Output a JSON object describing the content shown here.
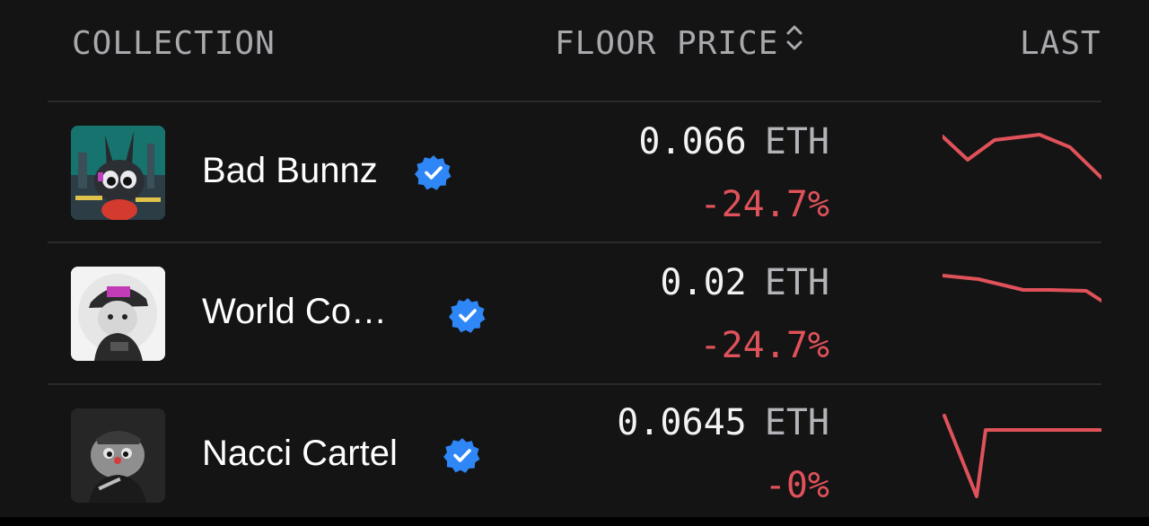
{
  "header": {
    "collection_label": "COLLECTION",
    "floor_price_label": "FLOOR PRICE",
    "last_label": "LAST"
  },
  "colors": {
    "background": "#141415",
    "negative": "#e0525a",
    "verified": "#2f86f6",
    "header_text": "#a9a9ad"
  },
  "rows": [
    {
      "name": "Bad Bunnz",
      "verified": true,
      "floor_value": "0.066",
      "floor_unit": "ETH",
      "change": "-24.7%"
    },
    {
      "name": "World Co…",
      "verified": true,
      "floor_value": "0.02",
      "floor_unit": "ETH",
      "change": "-24.7%"
    },
    {
      "name": "Nacci Cartel",
      "verified": true,
      "floor_value": "0.0645",
      "floor_unit": "ETH",
      "change": "-0%"
    }
  ]
}
